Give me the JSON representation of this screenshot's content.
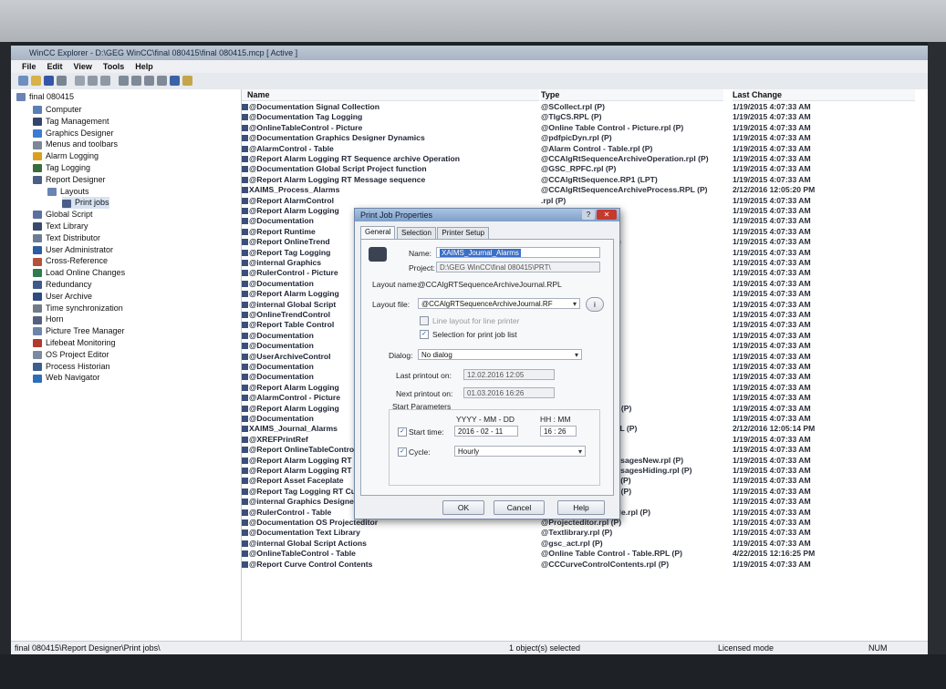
{
  "window": {
    "title": "WinCC Explorer - D:\\GEG WinCC\\final 080415\\final 080415.mcp [ Active ]"
  },
  "menu": [
    "File",
    "Edit",
    "View",
    "Tools",
    "Help"
  ],
  "tree": {
    "root": "final 080415",
    "items": [
      {
        "label": "Computer",
        "color": "#5a7fb5"
      },
      {
        "label": "Tag Management",
        "color": "#34456b"
      },
      {
        "label": "Graphics Designer",
        "color": "#3c7bd1"
      },
      {
        "label": "Menus and toolbars",
        "color": "#7a8898"
      },
      {
        "label": "Alarm Logging",
        "color": "#d9a020"
      },
      {
        "label": "Tag Logging",
        "color": "#3a6d3a"
      },
      {
        "label": "Report Designer",
        "color": "#4a5e86"
      },
      {
        "label": "Layouts",
        "color": "#6b84b3"
      },
      {
        "label": "Print jobs",
        "color": "#4a5e86"
      },
      {
        "label": "Global Script",
        "color": "#5b6fa0"
      },
      {
        "label": "Text Library",
        "color": "#394a6e"
      },
      {
        "label": "Text Distributor",
        "color": "#6b7b96"
      },
      {
        "label": "User Administrator",
        "color": "#2b5da0"
      },
      {
        "label": "Cross-Reference",
        "color": "#b5503a"
      },
      {
        "label": "Load Online Changes",
        "color": "#2f7b50"
      },
      {
        "label": "Redundancy",
        "color": "#3e5a8a"
      },
      {
        "label": "User Archive",
        "color": "#2f4a80"
      },
      {
        "label": "Time synchronization",
        "color": "#707a88"
      },
      {
        "label": "Horn",
        "color": "#556080"
      },
      {
        "label": "Picture Tree Manager",
        "color": "#6a85a8"
      },
      {
        "label": "Lifebeat Monitoring",
        "color": "#b03a2e"
      },
      {
        "label": "OS Project Editor",
        "color": "#7a8aa0"
      },
      {
        "label": "Process Historian",
        "color": "#3a5e8e"
      },
      {
        "label": "Web Navigator",
        "color": "#2c6fb8"
      }
    ]
  },
  "list": {
    "headers": {
      "name": "Name",
      "type": "Type",
      "date": "Last Change"
    },
    "rows": [
      {
        "name": "@Documentation Signal Collection",
        "type": "@SCollect.rpl (P)",
        "date": "1/19/2015 4:07:33 AM"
      },
      {
        "name": "@Documentation Tag Logging",
        "type": "@TlgCS.RPL (P)",
        "date": "1/19/2015 4:07:33 AM"
      },
      {
        "name": "@OnlineTableControl - Picture",
        "type": "@Online Table Control - Picture.rpl (P)",
        "date": "1/19/2015 4:07:33 AM"
      },
      {
        "name": "@Documentation Graphics Designer Dynamics",
        "type": "@pdfpicDyn.rpl (P)",
        "date": "1/19/2015 4:07:33 AM"
      },
      {
        "name": "@AlarmControl - Table",
        "type": "@Alarm Control - Table.rpl (P)",
        "date": "1/19/2015 4:07:33 AM"
      },
      {
        "name": "@Report Alarm Logging RT Sequence archive Operation",
        "type": "@CCAlgRtSequenceArchiveOperation.rpl (P)",
        "date": "1/19/2015 4:07:33 AM"
      },
      {
        "name": "@Documentation Global Script Project function",
        "type": "@GSC_RPFC.rpl (P)",
        "date": "1/19/2015 4:07:33 AM"
      },
      {
        "name": "@Report Alarm Logging RT Message sequence",
        "type": "@CCAlgRtSequence.RP1 (LPT)",
        "date": "1/19/2015 4:07:33 AM"
      },
      {
        "name": "XAIMS_Process_Alarms",
        "type": "@CCAlgRtSequenceArchiveProcess.RPL (P)",
        "date": "2/12/2016 12:05:20 PM"
      },
      {
        "name": "@Report AlarmControl",
        "type": ".rpl (P)",
        "date": "1/19/2015 4:07:33 AM"
      },
      {
        "name": "@Report Alarm Logging",
        "type": "MessagesOld.rpl (P)",
        "date": "1/19/2015 4:07:33 AM"
      },
      {
        "name": "@Documentation",
        "type": "",
        "date": "1/19/2015 4:07:33 AM"
      },
      {
        "name": "@Report Runtime",
        "type": "e List.RPL (P)",
        "date": "1/19/2015 4:07:33 AM"
      },
      {
        "name": "@Report OnlineTrend",
        "type": "Ctrl-Curves-CP.rpl (P)",
        "date": "1/19/2015 4:07:33 AM"
      },
      {
        "name": "@Report Tag Logging",
        "type": "ol (P)",
        "date": "1/19/2015 4:07:33 AM"
      },
      {
        "name": "@internal Graphics",
        "type": "",
        "date": "1/19/2015 4:07:33 AM"
      },
      {
        "name": "@RulerControl - Picture",
        "type": "icture.rpl (P)",
        "date": "1/19/2015 4:07:33 AM"
      },
      {
        "name": "@Documentation",
        "type": "cape).rpl (P)",
        "date": "1/19/2015 4:07:33 AM"
      },
      {
        "name": "@Report Alarm Logging",
        "type": "rmArchive.rpl (P)",
        "date": "1/19/2015 4:07:33 AM"
      },
      {
        "name": "@internal Global Script",
        "type": "",
        "date": "1/19/2015 4:07:33 AM"
      },
      {
        "name": "@OnlineTrendControl",
        "type": "ntrol - Picture.rpl (P)",
        "date": "1/19/2015 4:07:33 AM"
      },
      {
        "name": "@Report Table Control",
        "type": "Contents.rpl (P)",
        "date": "1/19/2015 4:07:33 AM"
      },
      {
        "name": "@Documentation",
        "type": "",
        "date": "1/19/2015 4:07:33 AM"
      },
      {
        "name": "@Documentation",
        "type": "",
        "date": "1/19/2015 4:07:33 AM"
      },
      {
        "name": "@UserArchiveControl",
        "type": "ntrol - Table.rpl (P)",
        "date": "1/19/2015 4:07:33 AM"
      },
      {
        "name": "@Documentation",
        "type": "",
        "date": "1/19/2015 4:07:33 AM"
      },
      {
        "name": "@Documentation",
        "type": "",
        "date": "1/19/2015 4:07:33 AM"
      },
      {
        "name": "@Report Alarm Logging",
        "type": ")",
        "date": "1/19/2015 4:07:33 AM"
      },
      {
        "name": "@AlarmControl - Picture",
        "type": "Picture.rpl (P)",
        "date": "1/19/2015 4:07:33 AM"
      },
      {
        "name": "@Report Alarm Logging",
        "type": "ceArchiveJournal.rpl (P)",
        "date": "1/19/2015 4:07:33 AM"
      },
      {
        "name": "@Documentation",
        "type": "",
        "date": "1/19/2015 4:07:33 AM"
      },
      {
        "name": "XAIMS_Journal_Alarms",
        "type": "ceArchiveJournal.RPL (P)",
        "date": "2/12/2016 12:05:14 PM"
      },
      {
        "name": "@XREFPrintRef",
        "type": "ol (P)",
        "date": "1/19/2015 4:07:33 AM"
      },
      {
        "name": "@Report OnlineTableControl",
        "type": "trl-CP.rpl (P)",
        "date": "1/19/2015 4:07:33 AM"
      },
      {
        "name": "@Report Alarm Logging RT OnlineMessages New",
        "type": "@CCAlgRtOnlineMessagesNew.rpl (P)",
        "date": "1/19/2015 4:07:33 AM"
      },
      {
        "name": "@Report Alarm Logging RT OnlineMessages Hiding",
        "type": "@CCAlgRtOnlineMessagesHiding.rpl (P)",
        "date": "1/19/2015 4:07:33 AM"
      },
      {
        "name": "@Report Asset Faceplate",
        "type": "@AssetFaceplate.rpl (P)",
        "date": "1/19/2015 4:07:33 AM"
      },
      {
        "name": "@Report Tag Logging RT Curves New",
        "type": "@CCTlgRtCurves.rpl (P)",
        "date": "1/19/2015 4:07:33 AM"
      },
      {
        "name": "@internal Graphics Designer Actions at the property",
        "type": "@akt_prop.rpl (P)",
        "date": "1/19/2015 4:07:33 AM"
      },
      {
        "name": "@RulerControl - Table",
        "type": "@Ruler Control - Table.rpl (P)",
        "date": "1/19/2015 4:07:33 AM"
      },
      {
        "name": "@Documentation OS Projecteditor",
        "type": "@Projecteditor.rpl (P)",
        "date": "1/19/2015 4:07:33 AM"
      },
      {
        "name": "@Documentation Text Library",
        "type": "@Textlibrary.rpl (P)",
        "date": "1/19/2015 4:07:33 AM"
      },
      {
        "name": "@internal Global Script Actions",
        "type": "@gsc_act.rpl (P)",
        "date": "1/19/2015 4:07:33 AM"
      },
      {
        "name": "@OnlineTableControl - Table",
        "type": "@Online Table Control - Table.RPL (P)",
        "date": "4/22/2015 12:16:25 PM"
      },
      {
        "name": "@Report Curve Control Contents",
        "type": "@CCCurveControlContents.rpl (P)",
        "date": "1/19/2015 4:07:33 AM"
      }
    ]
  },
  "status": {
    "path": "final 080415\\Report Designer\\Print jobs\\",
    "count": "1 object(s) selected",
    "mode": "Licensed mode",
    "num": "NUM"
  },
  "dialog": {
    "title": "Print Job Properties",
    "help_glyph": "?",
    "close_glyph": "✕",
    "tabs": [
      "General",
      "Selection",
      "Printer Setup"
    ],
    "name_label": "Name:",
    "name_value": "XAIMS_Journal_Alarms",
    "project_label": "Project:",
    "project_value": "D:\\GEG WinCC\\final 080415\\PRT\\",
    "layout_name_label": "Layout name:",
    "layout_name_value": "@CCAlgRTSequenceArchiveJournal.RPL",
    "layout_file_label": "Layout file:",
    "layout_file_value": "@CCAlgRTSequenceArchiveJournal.RF",
    "line_layout_label": "Line layout for line printer",
    "selection_label": "Selection for print job list",
    "dialog_label": "Dialog:",
    "dialog_value": "No dialog",
    "last_printout_label": "Last printout on:",
    "last_printout_value": "12.02.2016  12:05",
    "next_printout_label": "Next printout on:",
    "next_printout_value": "01.03.2016  16:26",
    "start_params_label": "Start Parameters",
    "date_format": "YYYY - MM - DD",
    "time_format": "HH : MM",
    "start_time_label": "Start time:",
    "start_date_value": "2016 - 02 - 11",
    "start_time_value": "16 : 26",
    "cycle_label": "Cycle:",
    "cycle_value": "Hourly",
    "ok": "OK",
    "cancel": "Cancel",
    "help": "Help"
  }
}
